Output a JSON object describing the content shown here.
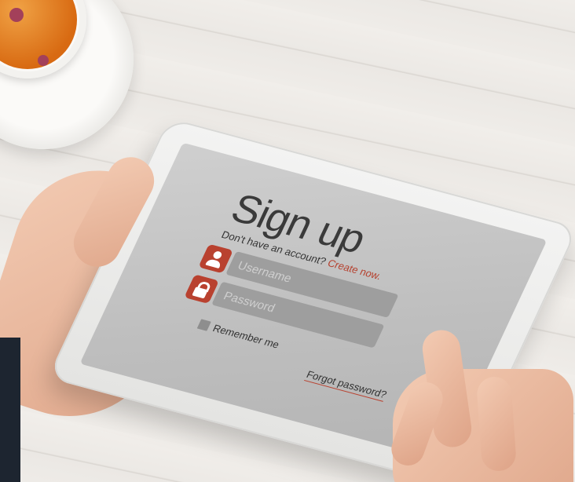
{
  "form": {
    "title": "Sign up",
    "subtitle_text": "Don't have an account?",
    "subtitle_link": "Create now.",
    "username_placeholder": "Username",
    "password_placeholder": "Password",
    "remember_label": "Remember me",
    "forgot_link": "Forgot password?"
  },
  "colors": {
    "accent": "#b9412f",
    "screen": "#c4c4c4",
    "field": "#9e9e9e"
  },
  "icons": [
    "user-icon",
    "lock-icon"
  ]
}
